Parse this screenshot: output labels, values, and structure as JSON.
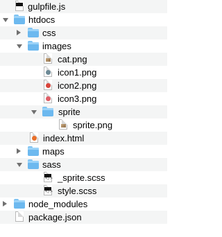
{
  "tree": [
    {
      "name": "gulpfile.js",
      "kind": "file",
      "icon": "js-file-icon"
    },
    {
      "name": "htdocs",
      "kind": "folder",
      "expanded": true
    },
    {
      "name": "css",
      "kind": "folder",
      "expanded": false
    },
    {
      "name": "images",
      "kind": "folder",
      "expanded": true
    },
    {
      "name": "cat.png",
      "kind": "file",
      "icon": "image-file-icon"
    },
    {
      "name": "icon1.png",
      "kind": "file",
      "icon": "image-file-icon",
      "color": "#6d8a96"
    },
    {
      "name": "icon2.png",
      "kind": "file",
      "icon": "image-file-icon",
      "color": "#d9443b"
    },
    {
      "name": "icon3.png",
      "kind": "file",
      "icon": "image-file-icon",
      "color": "#e05e66"
    },
    {
      "name": "sprite",
      "kind": "folder",
      "expanded": true
    },
    {
      "name": "sprite.png",
      "kind": "file",
      "icon": "image-file-icon"
    },
    {
      "name": "index.html",
      "kind": "file",
      "icon": "html-file-icon",
      "color": "#e8702a"
    },
    {
      "name": "maps",
      "kind": "folder",
      "expanded": false
    },
    {
      "name": "sass",
      "kind": "folder",
      "expanded": true
    },
    {
      "name": "_sprite.scss",
      "kind": "file",
      "icon": "scss-file-icon"
    },
    {
      "name": "style.scss",
      "kind": "file",
      "icon": "scss-file-icon"
    },
    {
      "name": "node_modules",
      "kind": "folder",
      "expanded": false
    },
    {
      "name": "package.json",
      "kind": "file",
      "icon": "json-file-icon"
    }
  ]
}
